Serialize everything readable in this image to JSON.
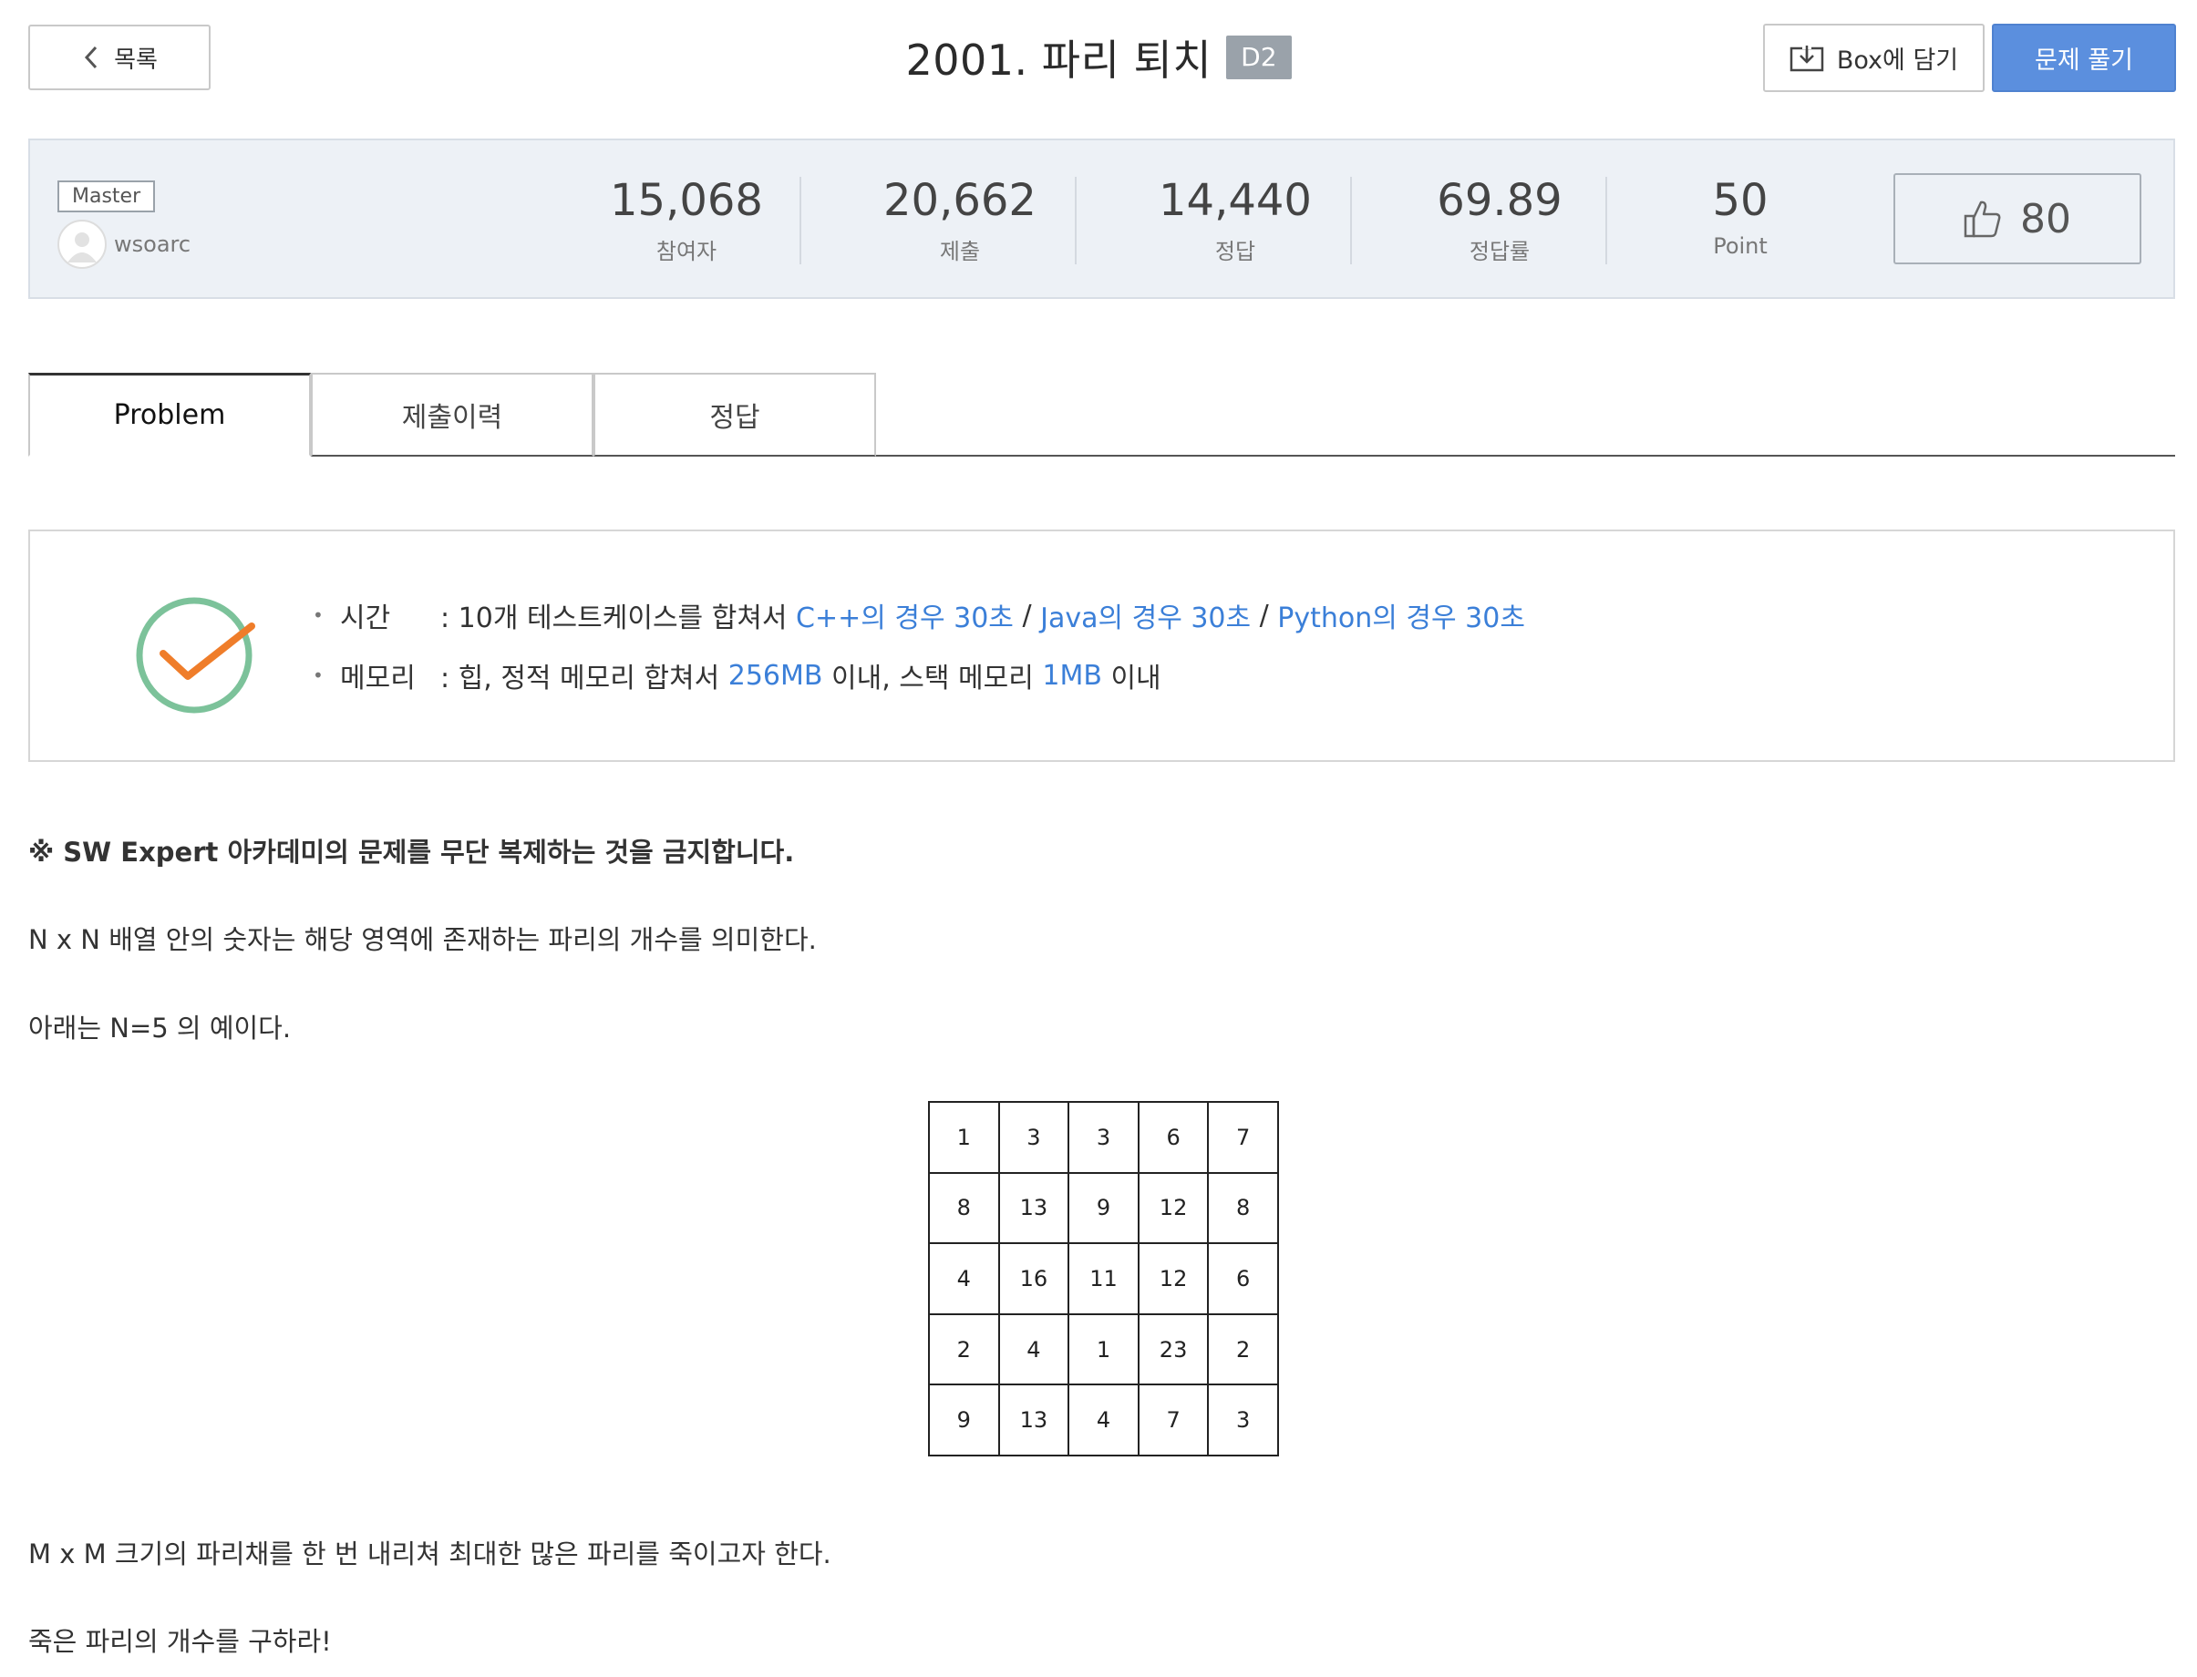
{
  "header": {
    "back_label": "목록",
    "title": "2001. 파리 퇴치",
    "level": "D2",
    "box_label": "Box에 담기",
    "solve_label": "문제 풀기"
  },
  "stats": {
    "level_tag": "Master",
    "author": "wsoarc",
    "items": [
      {
        "value": "15,068",
        "label": "참여자"
      },
      {
        "value": "20,662",
        "label": "제출"
      },
      {
        "value": "14,440",
        "label": "정답"
      },
      {
        "value": "69.89",
        "label": "정답률"
      },
      {
        "value": "50",
        "label": "Point"
      }
    ],
    "likes": "80"
  },
  "tabs": [
    {
      "label": "Problem",
      "active": true
    },
    {
      "label": "제출이력",
      "active": false
    },
    {
      "label": "정답",
      "active": false
    }
  ],
  "limits": {
    "time_label": "시간",
    "time_prefix": ": 10개 테스트케이스를 합쳐서 ",
    "time_cpp": "C++의 경우 30초",
    "sep1": " / ",
    "time_java": "Java의 경우 30초",
    "sep2": " / ",
    "time_python": "Python의 경우 30초",
    "memory_label": "메모리",
    "memory_prefix": ": 힙, 정적 메모리 합쳐서 ",
    "memory_heap": "256MB",
    "memory_mid": " 이내, 스택 메모리 ",
    "memory_stack": "1MB",
    "memory_suffix": " 이내"
  },
  "content": {
    "notice": "※ SW Expert 아카데미의 문제를 무단 복제하는 것을 금지합니다.",
    "p1": "N x N 배열 안의 숫자는 해당 영역에 존재하는 파리의 개수를 의미한다.",
    "p2": "아래는 N=5 의 예이다.",
    "grid": [
      [
        "1",
        "3",
        "3",
        "6",
        "7"
      ],
      [
        "8",
        "13",
        "9",
        "12",
        "8"
      ],
      [
        "4",
        "16",
        "11",
        "12",
        "6"
      ],
      [
        "2",
        "4",
        "1",
        "23",
        "2"
      ],
      [
        "9",
        "13",
        "4",
        "7",
        "3"
      ]
    ],
    "p3": "M x M 크기의 파리채를 한 번 내리쳐 최대한 많은 파리를 죽이고자 한다.",
    "p4": "죽은 파리의 개수를 구하라!"
  },
  "colors": {
    "accent": "#5b8fde",
    "link": "#3b7fd8",
    "check_circle": "#7cc29a",
    "check_mark": "#ef7d2a"
  }
}
